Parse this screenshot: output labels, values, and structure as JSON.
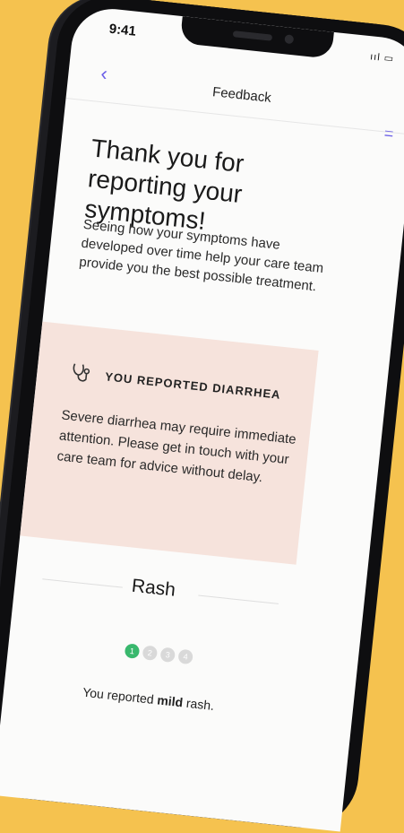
{
  "status": {
    "time": "9:41",
    "icons": "ııl ▭"
  },
  "nav": {
    "back": "‹",
    "title": "Feedback",
    "menu": "="
  },
  "heading": "Thank you for reporting your symptoms!",
  "intro": "Seeing how your symptoms have developed over time help your care team provide you the best possible treatment.",
  "alert": {
    "icon": "stethoscope-icon",
    "title": "YOU REPORTED DIARRHEA",
    "text": "Severe diarrhea may require immediate attention. Please get in touch with your care team for advice without delay."
  },
  "rash": {
    "title": "Rash",
    "steps": [
      "1",
      "2",
      "3",
      "4"
    ],
    "note_prefix": "You reported ",
    "note_level": "mild",
    "note_suffix": " rash."
  }
}
